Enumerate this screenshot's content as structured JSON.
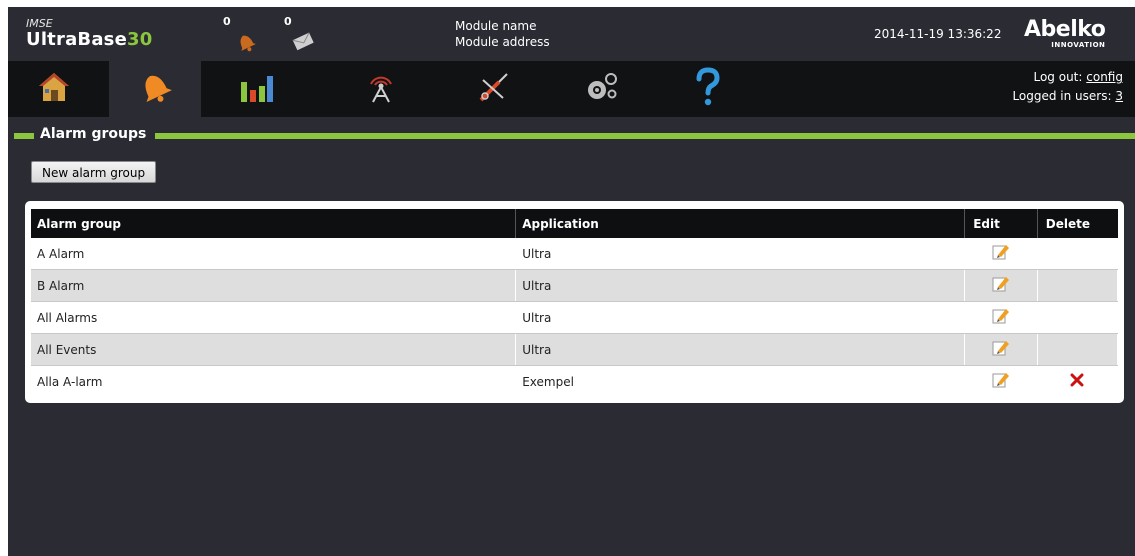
{
  "header": {
    "brand_prefix": "IMSE",
    "brand_name": "UltraBase",
    "brand_suffix": "30",
    "alarm_count": "0",
    "message_count": "0",
    "module_name": "Module name",
    "module_address": "Module address",
    "datetime": "2014-11-19 13:36:22",
    "logo_text": "Abelko",
    "logo_sub": "INNOVATION"
  },
  "nav": {
    "items": [
      {
        "name": "home",
        "icon": "house-icon"
      },
      {
        "name": "alarms",
        "icon": "bell-icon",
        "active": true
      },
      {
        "name": "charts",
        "icon": "bar-chart-icon"
      },
      {
        "name": "communication",
        "icon": "antenna-icon"
      },
      {
        "name": "service",
        "icon": "tools-icon"
      },
      {
        "name": "settings",
        "icon": "gears-icon"
      },
      {
        "name": "help",
        "icon": "question-icon"
      }
    ],
    "logout_label": "Log out:",
    "logout_user": "config",
    "logged_in_label": "Logged in users:",
    "logged_in_count": "3"
  },
  "section": {
    "title": "Alarm groups",
    "new_button": "New alarm group"
  },
  "table": {
    "headers": [
      "Alarm group",
      "Application",
      "Edit",
      "Delete"
    ],
    "rows": [
      {
        "group": "A Alarm",
        "application": "Ultra",
        "deletable": false
      },
      {
        "group": "B Alarm",
        "application": "Ultra",
        "deletable": false
      },
      {
        "group": "All Alarms",
        "application": "Ultra",
        "deletable": false
      },
      {
        "group": "All Events",
        "application": "Ultra",
        "deletable": false
      },
      {
        "group": "Alla A-larm",
        "application": "Exempel",
        "deletable": true
      }
    ]
  },
  "colors": {
    "accent": "#8cc63f",
    "background": "#2a2b33",
    "navbar": "#111214",
    "delete_red": "#cc1111",
    "edit_orange": "#f0a020"
  }
}
